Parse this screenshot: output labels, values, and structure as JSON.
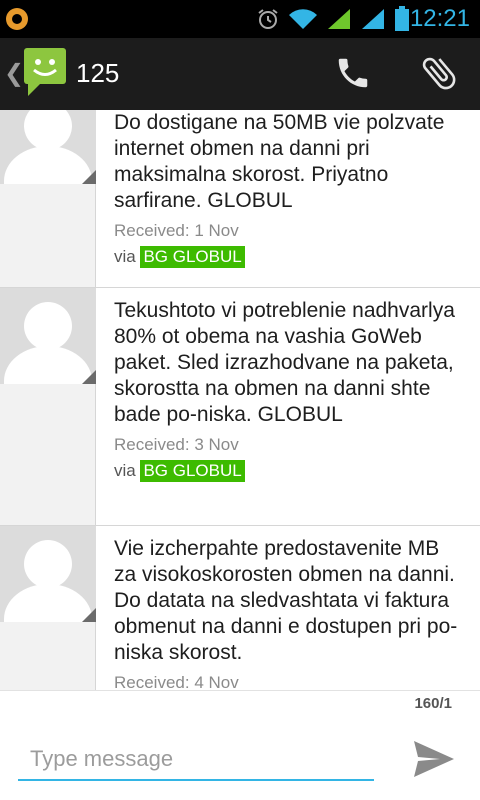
{
  "status_bar": {
    "time": "12:21",
    "icons": [
      "app-notification-icon",
      "alarm-icon",
      "wifi-icon",
      "signal-icon",
      "signal-icon",
      "battery-icon"
    ]
  },
  "action_bar": {
    "title": "125",
    "app_icon": "messaging-icon",
    "actions": [
      "call-icon",
      "attach-icon"
    ]
  },
  "messages": [
    {
      "text": "Do dostigane na 50MB vie polzvate internet obmen na danni pri maksimalna skorost. Priyatno sarfirane. GLOBUL",
      "received": "Received: 1 Nov",
      "via_label": "via",
      "operator": "BG GLOBUL"
    },
    {
      "text": "Tekushtoto vi potreblenie nadhvarlya 80% ot obema na vashia GoWeb paket. Sled izrazhodvane na paketa, skorostta na obmen na danni shte bade po-niska. GLOBUL",
      "received": "Received: 3 Nov",
      "via_label": "via",
      "operator": "BG GLOBUL"
    },
    {
      "text": "Vie izcherpahte predostavenite MB za visokoskorosten obmen na danni. Do datata na sledvashtata vi faktura obmenut na danni e dostupen pri po-niska skorost.",
      "received": "Received: 4 Nov"
    }
  ],
  "compose": {
    "char_counter": "160/1",
    "placeholder": "Type message",
    "value": ""
  },
  "colors": {
    "accent": "#33b5e5",
    "operator_badge": "#3dbb00",
    "action_bar": "#1c1c1c"
  }
}
